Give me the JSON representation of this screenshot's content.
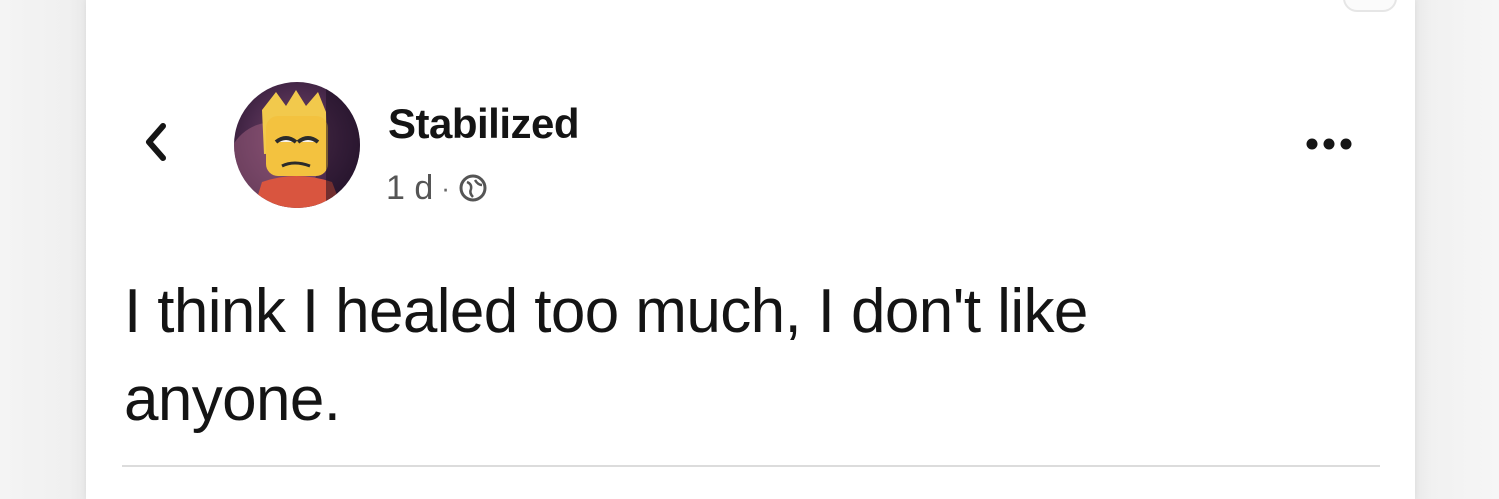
{
  "post": {
    "author_name": "Stabilized",
    "time_ago": "1 d",
    "separator": "·",
    "privacy_icon": "globe-icon",
    "text": "I think I healed too much, I don't like anyone."
  },
  "icons": {
    "back": "chevron-left-icon",
    "more": "more-horizontal-icon",
    "avatar": "profile-avatar"
  },
  "colors": {
    "background": "#ffffff",
    "page_edge": "#f3f3f3",
    "text_primary": "#141414",
    "text_secondary": "#555555",
    "divider": "#dcdcdc"
  }
}
